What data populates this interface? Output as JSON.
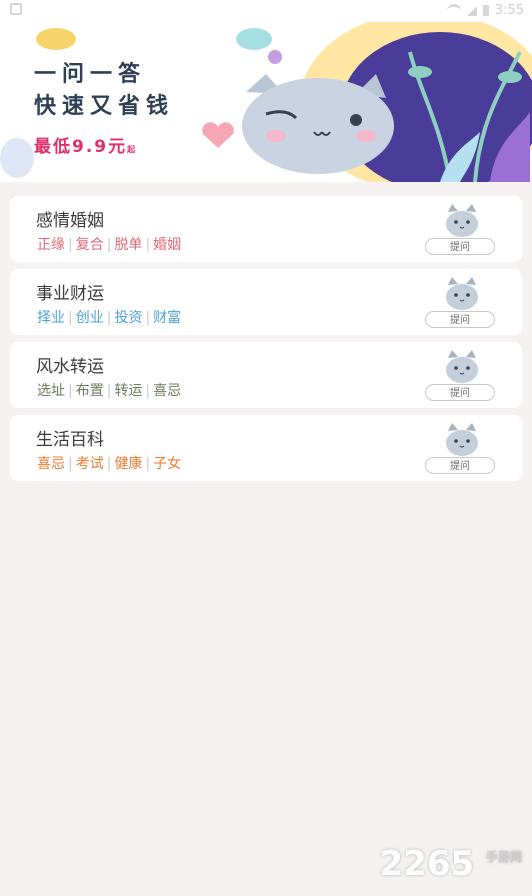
{
  "status": {
    "time": "3:55"
  },
  "banner": {
    "line1": "一问一答",
    "line2": "快速又省钱",
    "price": "最低9.9元",
    "price_suffix": "起"
  },
  "categories": [
    {
      "title": "感情婚姻",
      "tags": [
        "正缘",
        "复合",
        "脱单",
        "婚姻"
      ],
      "button": "提问",
      "color": "#e06a78"
    },
    {
      "title": "事业财运",
      "tags": [
        "择业",
        "创业",
        "投资",
        "财富"
      ],
      "button": "提问",
      "color": "#4aa3d9"
    },
    {
      "title": "风水转运",
      "tags": [
        "选址",
        "布置",
        "转运",
        "喜忌"
      ],
      "button": "提问",
      "color": "#6a7d5c"
    },
    {
      "title": "生活百科",
      "tags": [
        "喜忌",
        "考试",
        "健康",
        "子女"
      ],
      "button": "提问",
      "color": "#f07a2e"
    }
  ],
  "watermark": {
    "main": "2265",
    "sub": "手游网"
  }
}
